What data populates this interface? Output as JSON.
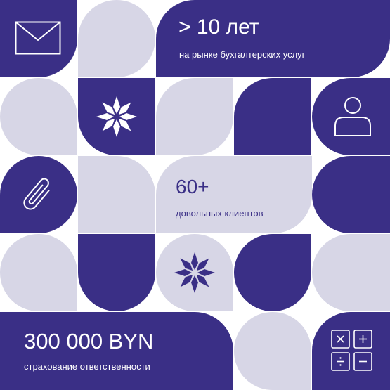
{
  "colors": {
    "navy": "#3a2f86",
    "lavender": "#d7d6e6",
    "white": "#ffffff"
  },
  "stat_years": {
    "value": "> 10 лет",
    "caption": "на рынке бухгалтерских услуг"
  },
  "stat_clients": {
    "value": "60+",
    "caption": "довольных клиентов"
  },
  "stat_insurance": {
    "value": "300 000 BYN",
    "caption": "страхование ответственности"
  },
  "icons": [
    "envelope-icon",
    "snowflake-ornament-icon",
    "user-icon",
    "paperclip-icon",
    "calculator-icon"
  ]
}
